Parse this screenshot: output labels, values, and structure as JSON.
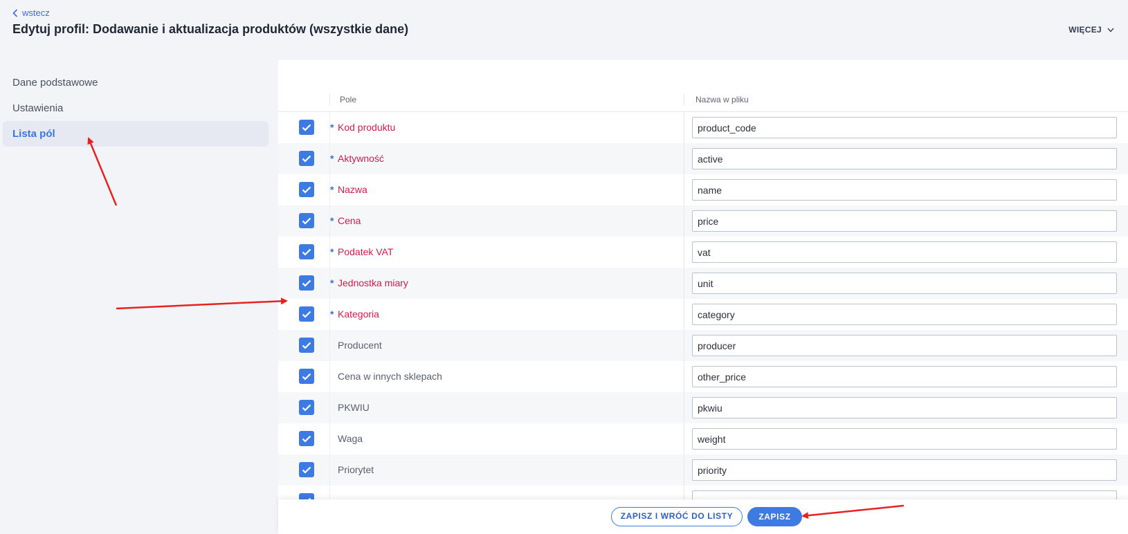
{
  "header": {
    "back_label": "wstecz",
    "title": "Edytuj profil: Dodawanie i aktualizacja produktów (wszystkie dane)",
    "more_label": "WIĘCEJ"
  },
  "sidebar": {
    "items": [
      {
        "label": "Dane podstawowe",
        "active": false
      },
      {
        "label": "Ustawienia",
        "active": false
      },
      {
        "label": "Lista pól",
        "active": true
      }
    ]
  },
  "table": {
    "columns": {
      "field": "Pole",
      "file_name": "Nazwa w pliku"
    },
    "required_marker": "*",
    "rows": [
      {
        "field": "Kod produktu",
        "required": true,
        "checked": true,
        "file_name": "product_code"
      },
      {
        "field": "Aktywność",
        "required": true,
        "checked": true,
        "file_name": "active"
      },
      {
        "field": "Nazwa",
        "required": true,
        "checked": true,
        "file_name": "name"
      },
      {
        "field": "Cena",
        "required": true,
        "checked": true,
        "file_name": "price"
      },
      {
        "field": "Podatek VAT",
        "required": true,
        "checked": true,
        "file_name": "vat"
      },
      {
        "field": "Jednostka miary",
        "required": true,
        "checked": true,
        "file_name": "unit"
      },
      {
        "field": "Kategoria",
        "required": true,
        "checked": true,
        "file_name": "category"
      },
      {
        "field": "Producent",
        "required": false,
        "checked": true,
        "file_name": "producer"
      },
      {
        "field": "Cena w innych sklepach",
        "required": false,
        "checked": true,
        "file_name": "other_price"
      },
      {
        "field": "PKWIU",
        "required": false,
        "checked": true,
        "file_name": "pkwiu"
      },
      {
        "field": "Waga",
        "required": false,
        "checked": true,
        "file_name": "weight"
      },
      {
        "field": "Priorytet",
        "required": false,
        "checked": true,
        "file_name": "priority"
      },
      {
        "field": "",
        "required": false,
        "checked": true,
        "file_name": ""
      }
    ]
  },
  "footer": {
    "save_and_back_label": "ZAPISZ I WRÓĆ DO LISTY",
    "save_label": "ZAPISZ"
  },
  "colors": {
    "accent": "#3d7be3",
    "required_text": "#d7194b",
    "annotation_arrow": "#e8211f"
  }
}
